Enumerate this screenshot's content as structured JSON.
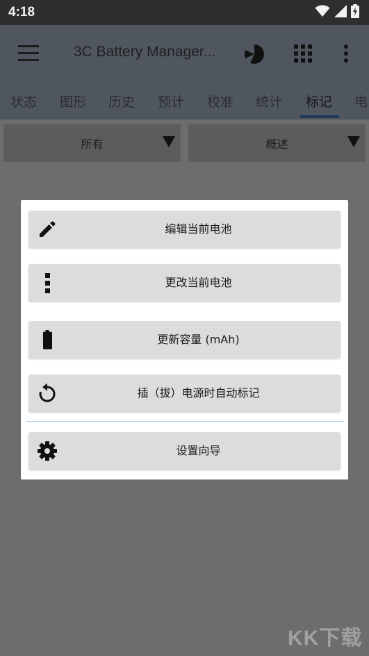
{
  "status_bar": {
    "time": "4:18",
    "icons": [
      "wifi-icon",
      "signal-icon",
      "battery-charging-icon"
    ]
  },
  "app_bar": {
    "title": "3C Battery Manager...",
    "menu_icon": "hamburger-menu-icon",
    "actions": [
      "pie-chart-icon",
      "grid-apps-icon",
      "more-vert-icon"
    ]
  },
  "tabs": [
    {
      "label": "状态"
    },
    {
      "label": "图形"
    },
    {
      "label": "历史"
    },
    {
      "label": "预计"
    },
    {
      "label": "校准"
    },
    {
      "label": "统计"
    },
    {
      "label": "标记",
      "active": true
    },
    {
      "label": "电"
    }
  ],
  "filters": {
    "left": {
      "value": "所有"
    },
    "right": {
      "value": "概述"
    }
  },
  "dialog": {
    "items": [
      {
        "label": "编辑当前电池",
        "icon": "pencil-icon"
      },
      {
        "label": "更改当前电池",
        "icon": "more-vert-icon"
      },
      {
        "label": "更新容量 (mAh)",
        "icon": "battery-icon"
      },
      {
        "label": "插（拔）电源时自动标记",
        "icon": "restore-icon"
      },
      {
        "label": "设置向导",
        "icon": "gear-icon"
      }
    ]
  },
  "watermark": "KK下载",
  "colors": {
    "status_bar": "#2e2e2e",
    "app_bar_dimmed": "#505660",
    "scrim": "#6d6d6d",
    "dialog_button": "#dcdcdc",
    "divider": "#b9d6ea"
  }
}
